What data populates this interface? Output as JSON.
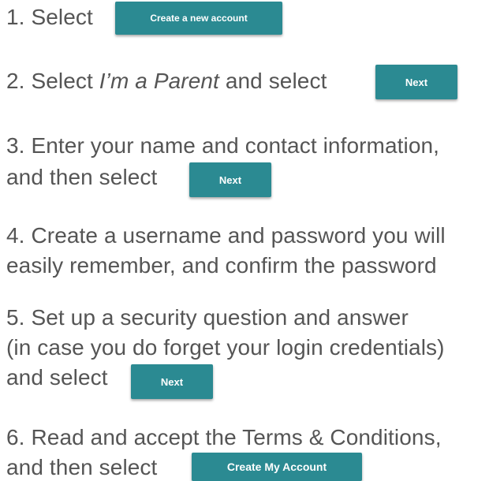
{
  "steps": [
    {
      "num": "1.",
      "text": "Select",
      "button": "Create a new account"
    },
    {
      "num": "2.",
      "text_pre": "Select",
      "text_italic": "I’m a Parent",
      "text_post": "and select",
      "button": "Next"
    },
    {
      "num": "3.",
      "line1": "Enter your name and contact information,",
      "line2": "and then select",
      "button": "Next"
    },
    {
      "num": "4.",
      "line1": "Create a username and password you will",
      "line2": "easily remember, and confirm the password"
    },
    {
      "num": "5.",
      "line1": "Set up a security question and answer",
      "line2": "(in case you do forget your login credentials)",
      "line3": "and select",
      "button": "Next"
    },
    {
      "num": "6.",
      "line1": "Read and accept the Terms & Conditions,",
      "line2": "and then select",
      "button": "Create My Account"
    }
  ],
  "colors": {
    "button_bg": "#2b8a92",
    "button_text": "#ffffff",
    "body_text": "#555555"
  }
}
